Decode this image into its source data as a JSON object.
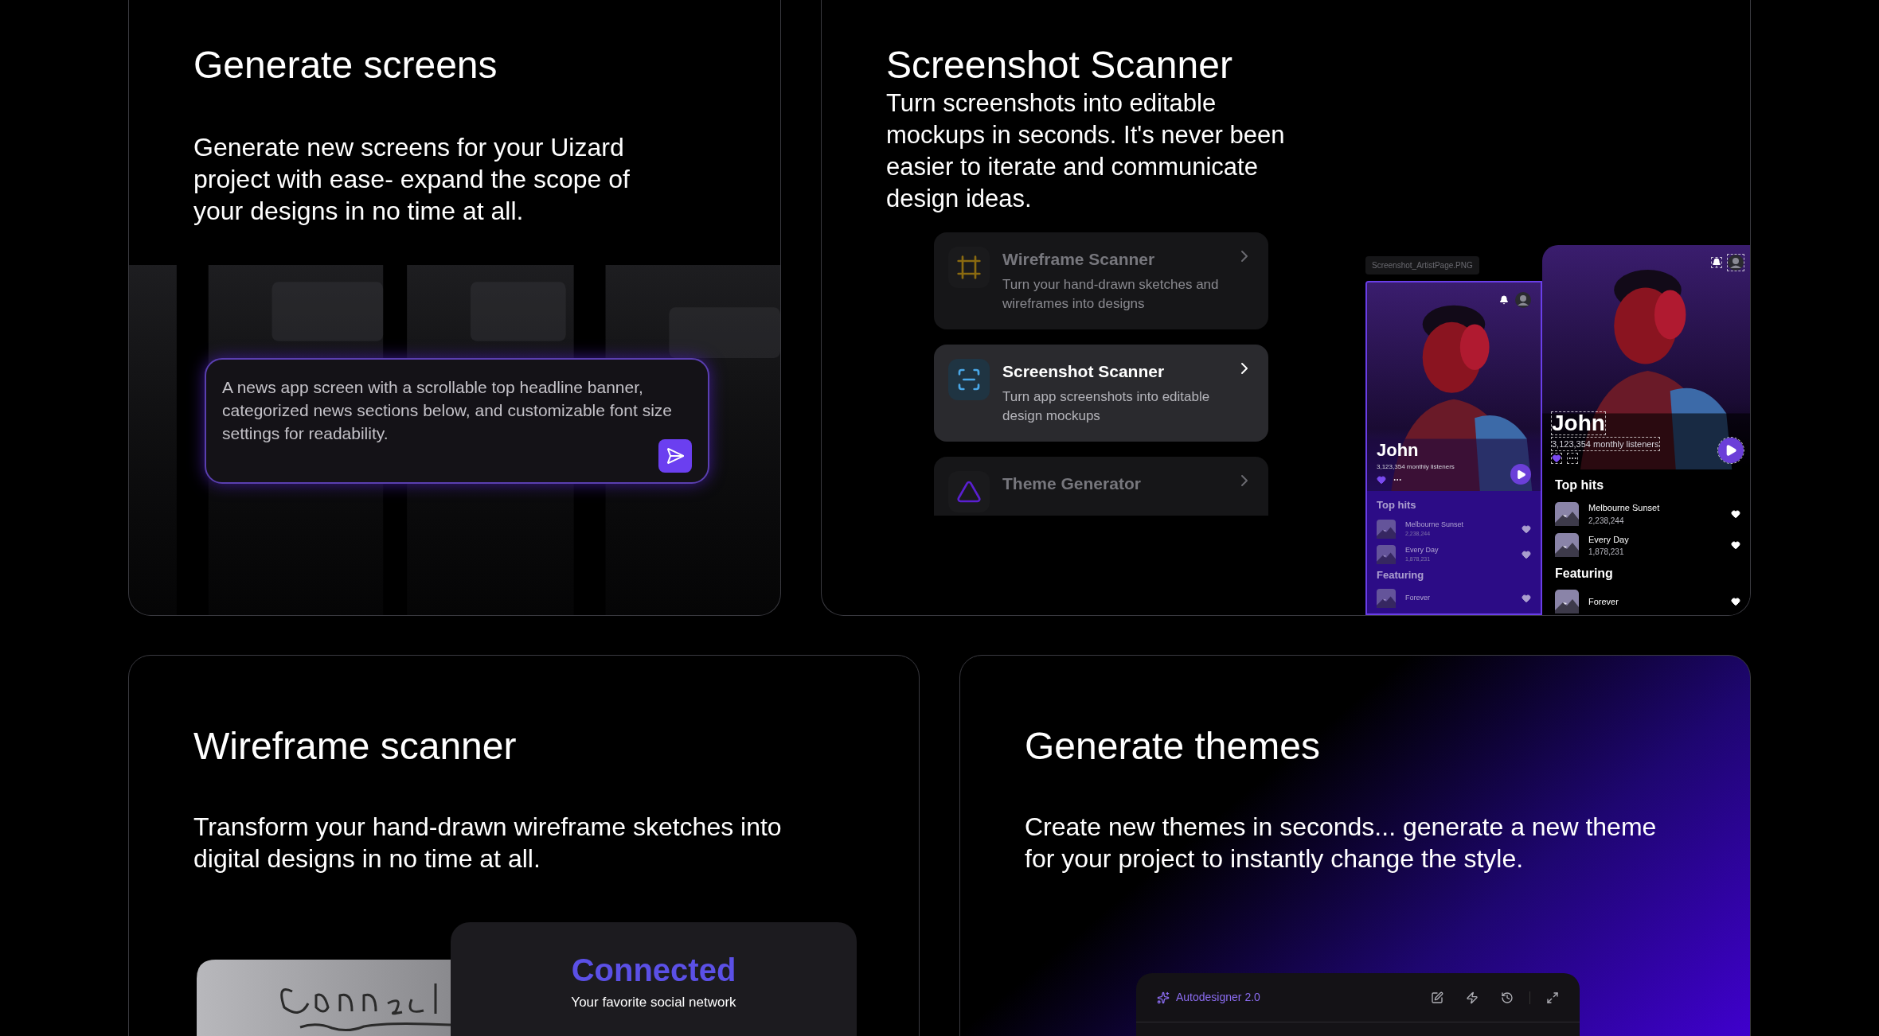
{
  "generate_screens": {
    "title": "Generate screens",
    "description": "Generate new screens for your Uizard project with ease- expand the scope of your designs in no time at all.",
    "prompt": {
      "value": "A news app screen with a scrollable top headline banner, categorized news sections below, and customizable font size settings for readability."
    }
  },
  "screenshot_scanner": {
    "title": "Screenshot Scanner",
    "description": "Turn screenshots into editable mockups in seconds. It's never been easier to iterate and communicate design ideas.",
    "features": [
      {
        "kind": "wireframe",
        "title": "Wireframe Scanner",
        "description": "Turn your hand-drawn sketches and wireframes into designs",
        "selected": false,
        "color": "#8a6a10"
      },
      {
        "kind": "screenshot",
        "title": "Screenshot Scanner",
        "description": "Turn app screenshots into editable design mockups",
        "selected": true,
        "color": "#4aa8e8"
      },
      {
        "kind": "theme",
        "title": "Theme Generator",
        "selected": false,
        "color": "#5a1fd0"
      }
    ],
    "mockups": [
      {
        "kind": "source",
        "file_label": "Screenshot_ArtistPage.PNG",
        "artist": "John",
        "listeners": "3,123,354 monthly listeners",
        "sections": [
          {
            "title": "Top hits",
            "songs": [
              {
                "title": "Melbourne Sunset",
                "plays": "2,238,244"
              },
              {
                "title": "Every Day",
                "plays": "1,878,231"
              }
            ]
          },
          {
            "title": "Featuring",
            "songs": [
              {
                "title": "Forever"
              }
            ]
          }
        ]
      },
      {
        "kind": "result",
        "artist": "John",
        "listeners": "3,123,354 monthly listeners",
        "sections": [
          {
            "title": "Top hits",
            "songs": [
              {
                "title": "Melbourne Sunset",
                "plays": "2,238,244"
              },
              {
                "title": "Every Day",
                "plays": "1,878,231"
              }
            ]
          },
          {
            "title": "Featuring",
            "songs": [
              {
                "title": "Forever"
              }
            ]
          }
        ]
      }
    ]
  },
  "wireframe_scanner": {
    "title": "Wireframe scanner",
    "description": "Transform your hand-drawn wireframe sketches into digital designs in no time at all.",
    "preview": {
      "title": "Connected",
      "subtitle": "Your favorite social network"
    }
  },
  "generate_themes": {
    "title": "Generate themes",
    "description": "Create new themes in seconds... generate a new theme for your project to instantly change the style.",
    "panel": {
      "title": "Autodesigner 2.0"
    }
  }
}
